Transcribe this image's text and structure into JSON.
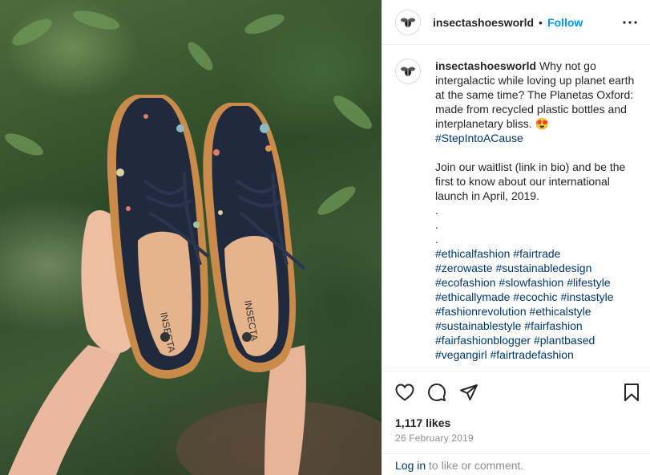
{
  "post": {
    "username": "insectashoesworld",
    "separator": "•",
    "follow_label": "Follow",
    "caption": {
      "lead": "Why not go intergalactic while loving up planet earth at the same time? The Planetas Oxford: made from recycled plastic bottles and interplanetary bliss. 😍",
      "tag1": "#StepIntoACause",
      "paragraph2": "Join our waitlist (link in bio) and be the first to know about our international launch in April, 2019.",
      "dots": [
        ".",
        ".",
        "."
      ],
      "hashtags": [
        "#ethicalfashion",
        "#fairtrade",
        "#zerowaste",
        "#sustainabledesign",
        "#ecofashion",
        "#slowfashion",
        "#lifestyle",
        "#ethicallymade",
        "#ecochic",
        "#instastyle",
        "#fashionrevolution",
        "#ethicalstyle",
        "#sustainablestyle",
        "#fairfashion",
        "#fairfashionblogger",
        "#plantbased",
        "#vegangirl",
        "#fairtradefashion"
      ]
    },
    "likes": "1,117 likes",
    "date": "26 February 2019",
    "login_link": "Log in",
    "login_text": " to like or comment."
  },
  "photo": {
    "insole_brand": "INSECTA"
  },
  "icons": {
    "more": "more-icon",
    "like": "heart-icon",
    "comment": "comment-icon",
    "share": "share-icon",
    "save": "bookmark-icon",
    "avatar": "bee-logo-icon"
  },
  "colors": {
    "accent": "#0095f6",
    "link": "#00376b",
    "muted": "#8e8e8e",
    "text": "#262626"
  }
}
